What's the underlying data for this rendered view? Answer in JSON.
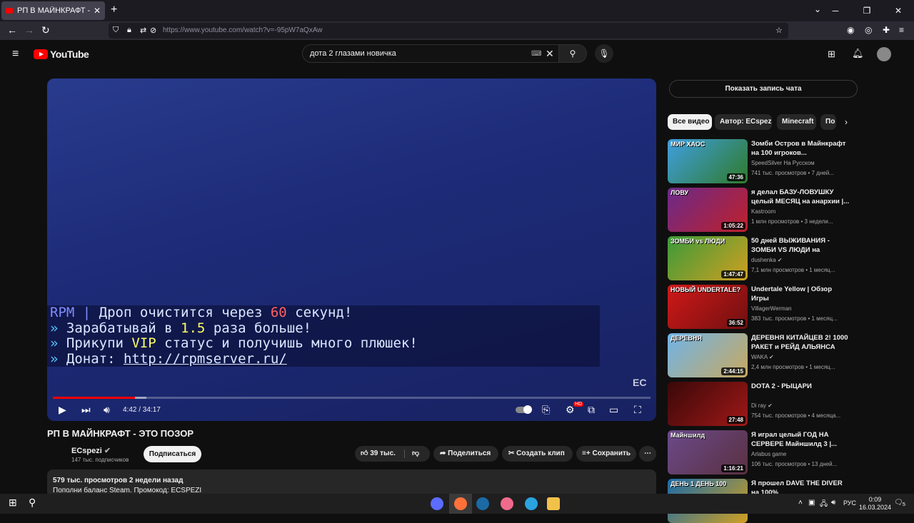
{
  "browser": {
    "tab_title": "РП В МАЙНКРАФТ - ЭТО ПОЗОР",
    "url": "https://www.youtube.com/watch?v=-95pW7aQxAw"
  },
  "header": {
    "logo_text": "YouTube",
    "search_value": "дота 2 глазами новичка"
  },
  "player": {
    "chat_lines": [
      [
        {
          "t": "RPM | ",
          "c": "c1"
        },
        {
          "t": "Дроп очистится через ",
          "c": "cw"
        },
        {
          "t": "60",
          "c": "cr"
        },
        {
          "t": " секунд!",
          "c": "cw"
        }
      ],
      [
        {
          "t": "» ",
          "c": "cb"
        },
        {
          "t": "Зарабатывай в ",
          "c": "cw"
        },
        {
          "t": "1.5",
          "c": "cy"
        },
        {
          "t": "  раза больше!",
          "c": "cw"
        }
      ],
      [
        {
          "t": "» ",
          "c": "cb"
        },
        {
          "t": "Прикупи ",
          "c": "cw"
        },
        {
          "t": "VIP",
          "c": "cy"
        },
        {
          "t": " статус и получишь много плюшек!",
          "c": "cw"
        }
      ],
      [
        {
          "t": "» ",
          "c": "cb"
        },
        {
          "t": "Донат: ",
          "c": "cw"
        },
        {
          "t": "http://rpmserver.ru/",
          "c": "cu"
        }
      ]
    ],
    "watermark": "EC",
    "time": "4:42 / 34:17",
    "progress_fraction": 0.137,
    "buffer_fraction": 0.156,
    "hd_badge": "HD"
  },
  "video": {
    "title": "РП В МАЙНКРАФТ - ЭТО ПОЗОР",
    "channel": "ECspezi",
    "subscribers": "147 тыс. подписчиков",
    "subscribe_label": "Подписаться",
    "likes": "39 тыс.",
    "share_label": "Поделиться",
    "clip_label": "Создать клип",
    "save_label": "Сохранить",
    "views_date": "579 тыс. просмотров  2 недели назад",
    "description": "Пополни баланс Steam. Промокод: ECSPEZI"
  },
  "sidebar": {
    "chat_replay": "Показать запись чата",
    "chips": [
      "Все видео",
      "Автор: ECspezi",
      "Minecraft",
      "По"
    ],
    "recs": [
      {
        "title": "Зомби Остров в Майнкрафт на 100 игроков...",
        "channel": "SpeedSilver На Русском",
        "meta": "741 тыс. просмотров  •  7 дней...",
        "duration": "47:36",
        "thumb_text": "МИР   ХАОС",
        "colors": [
          "#3f9fe0",
          "#2f7a2a"
        ]
      },
      {
        "title": "я делал БАЗУ-ЛОВУШКУ целый МЕСЯЦ на анархии |...",
        "channel": "Kastroom",
        "meta": "1 млн просмотров  •  3 недели...",
        "duration": "1:05:22",
        "thumb_text": "ЛОВУ",
        "colors": [
          "#6a2a8a",
          "#c0202a"
        ]
      },
      {
        "title": "50 дней ВЫЖИВАНИЯ - ЗОМБИ VS ЛЮДИ на хардкоре",
        "channel": "dushenka ✔",
        "meta": "7,1 млн просмотров  •  1 месяц...",
        "duration": "1:47:47",
        "thumb_text": "ЗОМБИ vs ЛЮДИ",
        "colors": [
          "#3a9a3a",
          "#d0a020"
        ]
      },
      {
        "title": "Undertale Yellow | Обзор Игры",
        "channel": "VillagerWerman",
        "meta": "383 тыс. просмотров  •  1 месяц...",
        "duration": "36:52",
        "thumb_text": "НОВЫЙ UNDERTALE?",
        "colors": [
          "#d01818",
          "#701010"
        ]
      },
      {
        "title": "ДЕРЕВНЯ КИТАЙЦЕВ 2! 1000 РАКЕТ и РЕЙД АЛЬЯНСА по...",
        "channel": "WAKA ✔",
        "meta": "2,4 млн просмотров  •  1 месяц...",
        "duration": "2:44:15",
        "thumb_text": "ДЕРЕВНЯ",
        "colors": [
          "#6fb4e8",
          "#c8a860"
        ]
      },
      {
        "title": "DOTA 2 - РЫЦАРИ",
        "channel": "Di ray ✔",
        "meta": "754 тыс. просмотров  •  4 месяца...",
        "duration": "27:48",
        "thumb_text": "",
        "colors": [
          "#3a0808",
          "#a01818"
        ]
      },
      {
        "title": "Я играл целый ГОД НА СЕРВЕРЕ Майншилд 3 |...",
        "channel": "Arlabus game",
        "meta": "106 тыс. просмотров  •  13 дней...",
        "duration": "1:16:21",
        "thumb_text": "Майншилд",
        "colors": [
          "#6a4a8a",
          "#5a3040"
        ]
      },
      {
        "title": "Я прошел DAVE THE DIVER на 100%",
        "channel": "",
        "meta": "",
        "duration": "",
        "thumb_text": "ДЕНЬ 1   ДЕНЬ 100",
        "colors": [
          "#1a6aa8",
          "#d0a020"
        ]
      }
    ]
  },
  "taskbar": {
    "lang": "РУС",
    "time": "0:09",
    "date": "16.03.2024",
    "notif_count": "5"
  }
}
